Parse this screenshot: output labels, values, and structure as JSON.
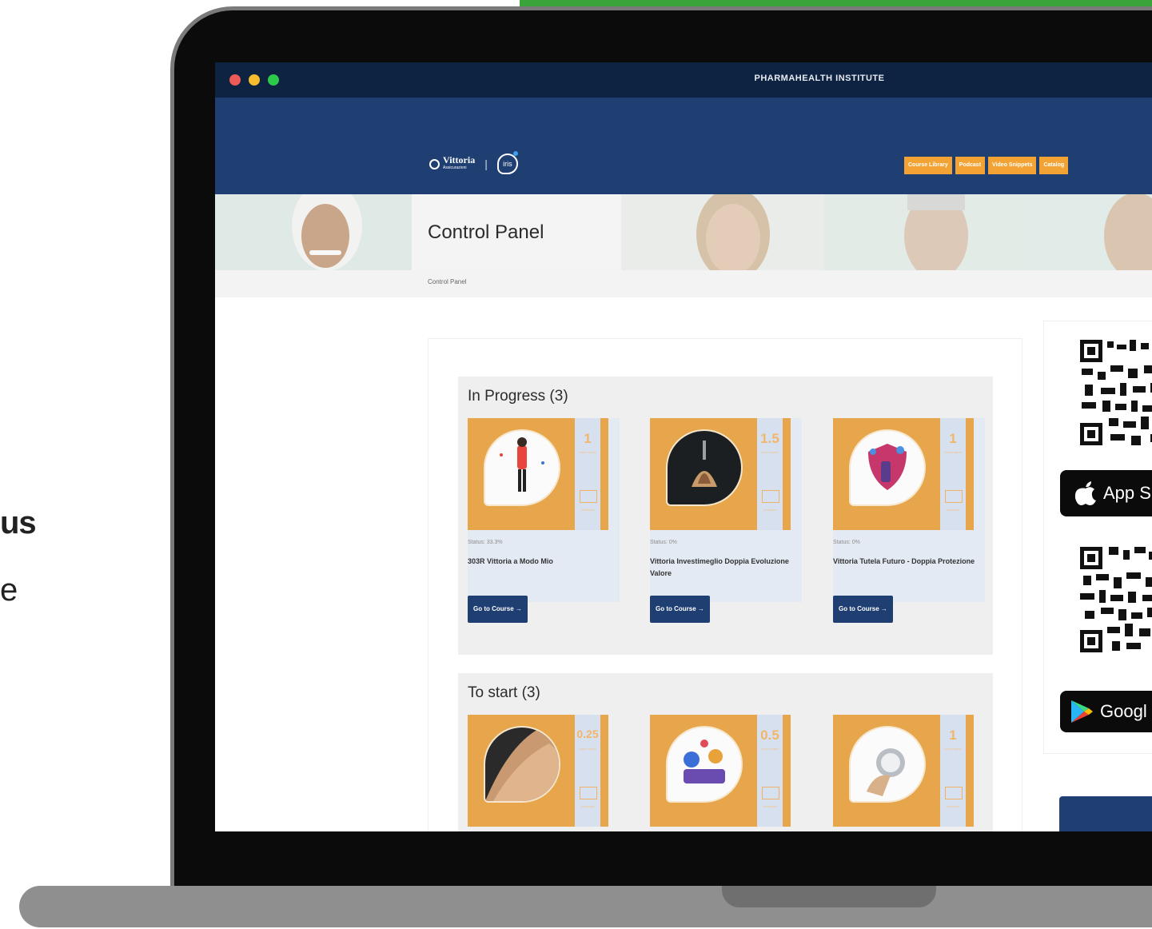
{
  "left_text": {
    "line1": "us",
    "line2": "e"
  },
  "window": {
    "title": "PHARMAHEALTH INSTITUTE"
  },
  "header": {
    "logo": {
      "brand": "Vittoria",
      "sub": "Assicurazioni",
      "partner": "iris"
    },
    "nav": [
      "Course Library",
      "Podcast",
      "Video Snippets",
      "Catalog"
    ]
  },
  "page": {
    "title": "Control Panel",
    "breadcrumb": "Control Panel"
  },
  "sections": {
    "in_progress": {
      "title": "In Progress (3)",
      "courses": [
        {
          "hours": "1",
          "hours_label": "hours spent",
          "cert_label": "certificate",
          "status": "Status: 33.3%",
          "name": "303R Vittoria a Modo Mio",
          "button": "Go to Course →"
        },
        {
          "hours": "1.5",
          "hours_label": "hours spent",
          "cert_label": "certificate",
          "status": "Status: 0%",
          "name": "Vittoria Investimeglio Doppia Evoluzione Valore",
          "button": "Go to Course →"
        },
        {
          "hours": "1",
          "hours_label": "hours spent",
          "cert_label": "certificate",
          "status": "Status: 0%",
          "name": "Vittoria Tutela Futuro - Doppia Protezione",
          "button": "Go to Course →"
        }
      ]
    },
    "to_start": {
      "title": "To start (3)",
      "courses": [
        {
          "hours": "0.25",
          "hours_label": "hours spent",
          "cert_label": "certificate"
        },
        {
          "hours": "0.5",
          "hours_label": "hours spent",
          "cert_label": "certificate"
        },
        {
          "hours": "1",
          "hours_label": "hours spent",
          "cert_label": "certificate"
        }
      ]
    }
  },
  "apps": {
    "apple_label": "App S",
    "google_label": "Googl"
  },
  "colors": {
    "navy": "#1f3f73",
    "orange": "#f3a333",
    "card_orange": "#e7a54c",
    "green": "#3aa43b"
  }
}
